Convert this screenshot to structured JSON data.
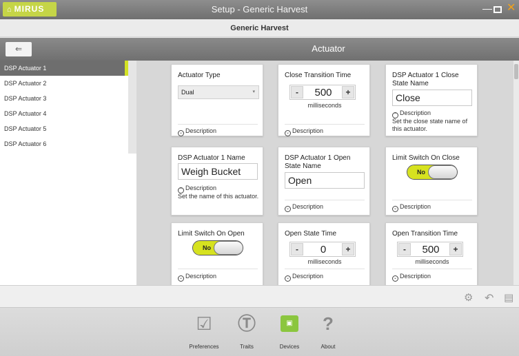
{
  "window": {
    "logo": "MIRUS",
    "title": "Setup - Generic Harvest",
    "minimize": "—",
    "close": "✕"
  },
  "subheader": "Generic Harvest",
  "section": {
    "back": "⇐",
    "title": "Actuator"
  },
  "sidebar": {
    "items": [
      {
        "label": "DSP Actuator 1"
      },
      {
        "label": "DSP Actuator 2"
      },
      {
        "label": "DSP Actuator 3"
      },
      {
        "label": "DSP Actuator 4"
      },
      {
        "label": "DSP Actuator 5"
      },
      {
        "label": "DSP Actuator 6"
      }
    ]
  },
  "cards": {
    "actuator_type": {
      "title": "Actuator Type",
      "value": "Dual",
      "desc": "Description"
    },
    "close_transition": {
      "title": "Close Transition Time",
      "minus": "-",
      "value": "500",
      "plus": "+",
      "unit": "milliseconds",
      "desc": "Description"
    },
    "close_state_name": {
      "title": "DSP Actuator 1 Close State Name",
      "value": "Close",
      "desc": "Description",
      "desc_text": "Set the close state name of this actuator."
    },
    "actuator_name": {
      "title": "DSP Actuator 1 Name",
      "value": "Weigh Bucket",
      "desc": "Description",
      "desc_text": "Set the name of this actuator."
    },
    "open_state_name": {
      "title": "DSP Actuator 1 Open State Name",
      "value": "Open",
      "desc": "Description"
    },
    "limit_close": {
      "title": "Limit Switch On Close",
      "value": "No",
      "desc": "Description"
    },
    "limit_open": {
      "title": "Limit Switch On Open",
      "value": "No",
      "desc": "Description"
    },
    "open_state_time": {
      "title": "Open State Time",
      "minus": "-",
      "value": "0",
      "plus": "+",
      "unit": "milliseconds",
      "desc": "Description"
    },
    "open_transition": {
      "title": "Open Transition Time",
      "minus": "-",
      "value": "500",
      "plus": "+",
      "unit": "milliseconds",
      "desc": "Description"
    }
  },
  "nav": {
    "preferences": "Preferences",
    "traits": "Traits",
    "devices": "Devices",
    "about": "About"
  },
  "icons": [
    "home-icon",
    "back-arrow-icon",
    "chevron-down-icon",
    "expand-icon",
    "collapse-icon",
    "settings-icon",
    "undo-icon",
    "save-icon",
    "preferences-icon",
    "traits-icon",
    "devices-icon",
    "about-icon"
  ],
  "colors": {
    "accent": "#d3e224",
    "selected": "#6e6e6e",
    "close": "#f2a11a"
  }
}
